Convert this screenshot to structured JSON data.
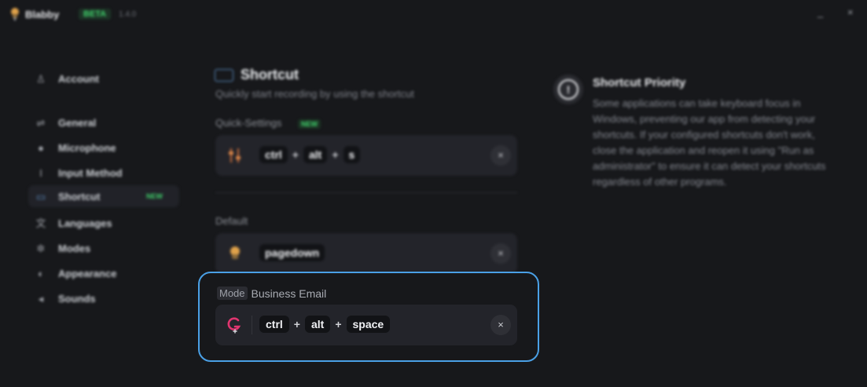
{
  "app": {
    "name": "Blabby",
    "badge": "BETA",
    "version": "1.4.0",
    "minimize_glyph": "_",
    "close_glyph": "×"
  },
  "sidebar": {
    "items": [
      {
        "label": "Account",
        "icon": "user-icon",
        "glyph": "♙"
      },
      {
        "label": "General",
        "icon": "sliders-icon",
        "glyph": "⇌"
      },
      {
        "label": "Microphone",
        "icon": "microphone-icon",
        "glyph": "●"
      },
      {
        "label": "Input Method",
        "icon": "text-cursor-icon",
        "glyph": "I"
      },
      {
        "label": "Shortcut",
        "icon": "keyboard-icon",
        "glyph": "▭",
        "active": true,
        "badge": "NEW"
      },
      {
        "label": "Languages",
        "icon": "translate-icon",
        "glyph": "文"
      },
      {
        "label": "Modes",
        "icon": "modes-icon",
        "glyph": "✲"
      },
      {
        "label": "Appearance",
        "icon": "palette-icon",
        "glyph": "◐"
      },
      {
        "label": "Sounds",
        "icon": "speaker-icon",
        "glyph": "◂"
      }
    ]
  },
  "main": {
    "title": "Shortcut",
    "subtitle": "Quickly start recording by using the shortcut",
    "quick_settings": {
      "label": "Quick-Settings",
      "badge": "NEW",
      "keys": [
        "ctrl",
        "alt",
        "s"
      ],
      "icon": "sliders-icon"
    },
    "default": {
      "label": "Default",
      "keys": [
        "pagedown"
      ],
      "icon": "microphone-mascot-icon"
    },
    "mode": {
      "tag": "Mode",
      "name": "Business Email",
      "keys": [
        "ctrl",
        "alt",
        "space"
      ],
      "icon": "g-logo-icon"
    },
    "plus": "+",
    "clear_glyph": "×"
  },
  "info": {
    "title": "Shortcut Priority",
    "glyph": "!",
    "body": "Some applications can take keyboard focus in Windows, preventing our app from detecting your shortcuts. If your configured shortcuts don't work, close the application and reopen it using \"Run as administrator\" to ensure it can detect your shortcuts regardless of other programs."
  },
  "colors": {
    "background": "#17181b",
    "card": "#23242a",
    "highlight_border": "#4aa0e6",
    "new_badge": "#3fcf6a",
    "logo_pink": "#e0356f"
  }
}
